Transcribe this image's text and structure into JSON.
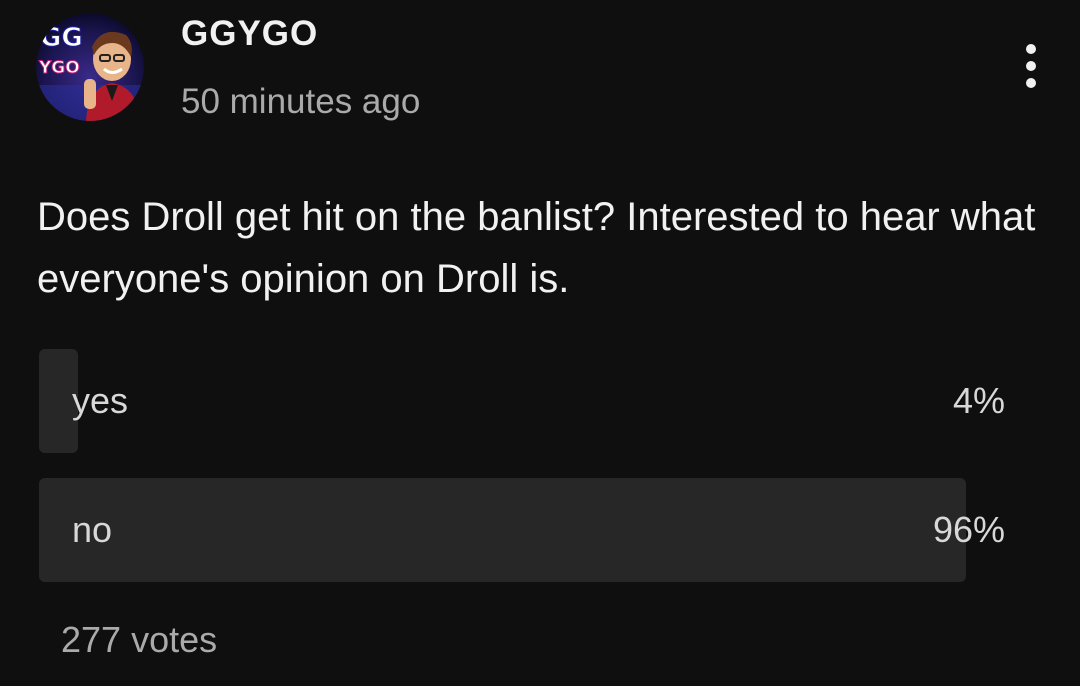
{
  "post": {
    "channel_name": "GGYGO",
    "timestamp": "50 minutes ago",
    "text": "Does Droll get hit on the banlist? Interested to hear what everyone's opinion on Droll is.",
    "avatar_text_top": "GG",
    "avatar_text_bottom": "YGO"
  },
  "poll": {
    "options": [
      {
        "label": "yes",
        "percent_text": "4%",
        "fraction": 0.04
      },
      {
        "label": "no",
        "percent_text": "96%",
        "fraction": 0.96
      }
    ],
    "votes_text": "277 votes"
  },
  "colors": {
    "background": "#0f0f0f",
    "bar_fill": "#272727",
    "primary_text": "#f1f1f1",
    "secondary_text": "#aaaaaa"
  },
  "icons": {
    "more": "more-vertical-icon",
    "avatar": "channel-avatar"
  }
}
